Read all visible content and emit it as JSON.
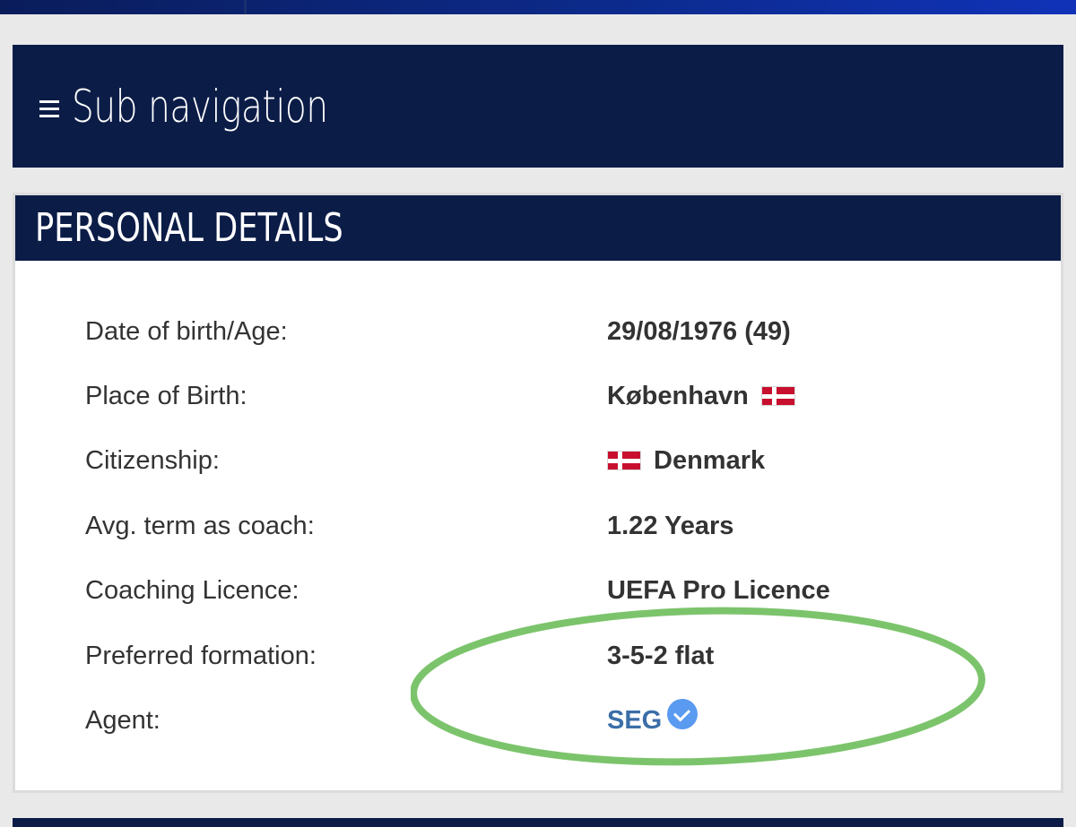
{
  "subnav": {
    "title": "Sub navigation",
    "menu_icon": "hamburger-icon"
  },
  "personal_details": {
    "header": "PERSONAL DETAILS",
    "rows": [
      {
        "label": "Date of birth/Age:",
        "value": "29/08/1976 (49)"
      },
      {
        "label": "Place of Birth:",
        "value": "København",
        "flag": "denmark-flag-icon"
      },
      {
        "label": "Citizenship:",
        "value": "Denmark",
        "flag": "denmark-flag-icon"
      },
      {
        "label": "Avg. term as coach:",
        "value": "1.22 Years"
      },
      {
        "label": "Coaching Licence:",
        "value": "UEFA Pro Licence"
      },
      {
        "label": "Preferred formation:",
        "value": "3-5-2 flat"
      },
      {
        "label": "Agent:",
        "value": "SEG",
        "badge": "verified-check-icon"
      }
    ]
  },
  "colors": {
    "header_bg": "#0b1c47",
    "agent_link": "#3b6ea8",
    "verified_badge": "#5a9af0",
    "annotation_circle": "#7cc46c"
  }
}
